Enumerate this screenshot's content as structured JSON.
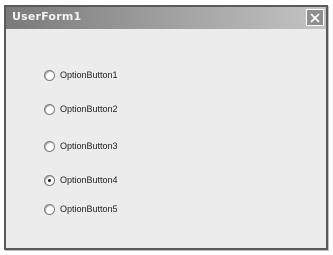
{
  "window": {
    "title": "UserForm1",
    "close_icon": "close-icon"
  },
  "options": [
    {
      "label": "OptionButton1",
      "selected": false
    },
    {
      "label": "OptionButton2",
      "selected": false
    },
    {
      "label": "OptionButton3",
      "selected": false
    },
    {
      "label": "OptionButton4",
      "selected": true
    },
    {
      "label": "OptionButton5",
      "selected": false
    }
  ]
}
